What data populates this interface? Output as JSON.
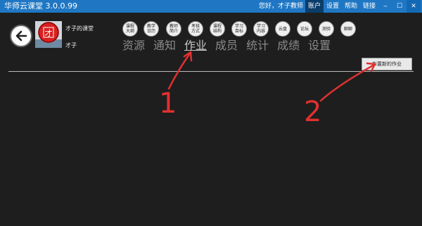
{
  "titlebar": {
    "app_title": "华师云课堂 3.0.0.99",
    "greeting": "您好，才子教师",
    "menu": [
      "账户",
      "设置",
      "帮助",
      "链接"
    ],
    "window_controls": [
      "‒",
      "☐",
      "✕"
    ]
  },
  "course": {
    "name": "才子的课堂",
    "teacher": "才子",
    "logo_text": "才"
  },
  "icons": [
    "课程\n大纲",
    "教学\n日历",
    "教师\n简介",
    "考核\n方式",
    "课程\n结构",
    "学习\n目标",
    "学习\n内容",
    "云盘",
    "论坛",
    "测验",
    "聊聊"
  ],
  "tabs": [
    "资源",
    "通知",
    "作业",
    "成员",
    "统计",
    "成绩",
    "设置"
  ],
  "active_tab": "作业",
  "publish_button": "布置新的作业",
  "annotations": [
    "1",
    "2"
  ],
  "colors": {
    "titlebar": "#1f77c4",
    "background": "#1e1e1e",
    "annotation": "#e03030"
  }
}
